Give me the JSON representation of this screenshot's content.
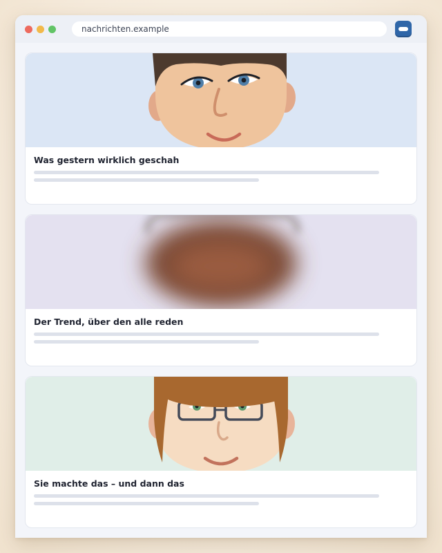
{
  "browser": {
    "url": "nachrichten.example",
    "traffic_lights": [
      "close",
      "minimize",
      "maximize"
    ],
    "extension_icon": "minus-pill-icon"
  },
  "colors": {
    "card1_bg": "#dbe6f5",
    "card2_bg": "#e4e1f0",
    "card3_bg": "#e0eee8",
    "accent": "#2f66a8"
  },
  "feed": {
    "items": [
      {
        "headline": "Was gestern wirklich geschah",
        "image": "cartoon-face-brown-hair"
      },
      {
        "headline": "Der Trend, über den alle reden",
        "image": "blurred-face"
      },
      {
        "headline": "Sie machte das – und dann das",
        "image": "cartoon-face-glasses-red-hair"
      }
    ]
  }
}
